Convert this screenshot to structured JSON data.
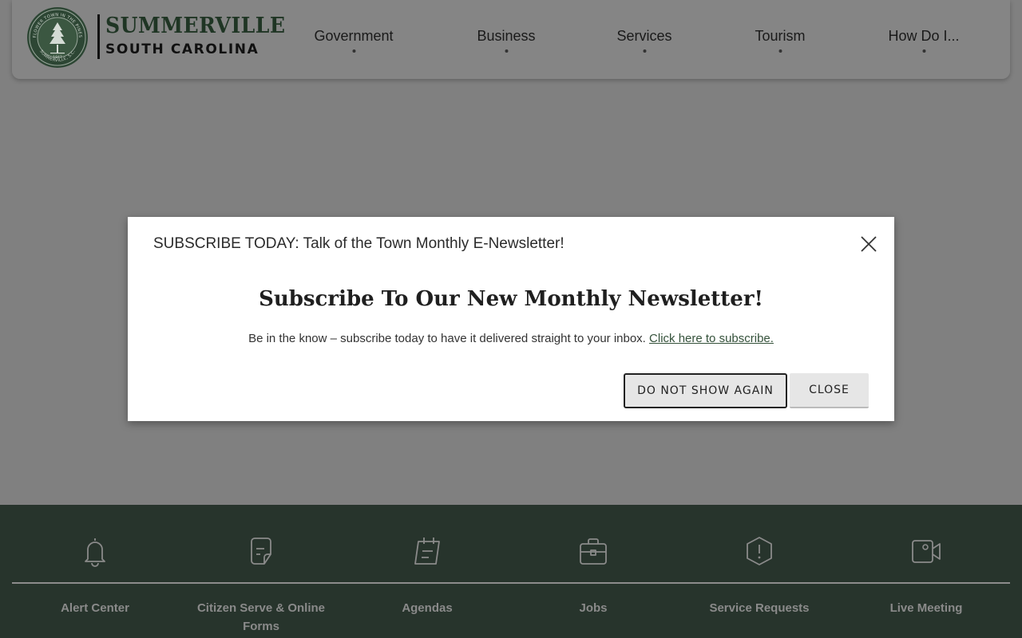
{
  "header": {
    "logo": {
      "name": "SUMMERVILLE",
      "state": "SOUTH CAROLINA",
      "seal_top": "FLOWER TOWN IN THE PINES",
      "seal_bottom": "SUMMERVILLE, S.C.",
      "seal_year": "1847"
    },
    "nav": [
      {
        "label": "Government"
      },
      {
        "label": "Business"
      },
      {
        "label": "Services"
      },
      {
        "label": "Tourism"
      },
      {
        "label": "How Do I..."
      }
    ]
  },
  "modal": {
    "title": "SUBSCRIBE TODAY: Talk of the Town Monthly E-Newsletter!",
    "heading": "Subscribe To Our New Monthly Newsletter!",
    "body_text": "Be in the know – subscribe today to have it delivered straight to your inbox.",
    "link_text": "Click here to subscribe.",
    "dont_show_label": "DO NOT SHOW AGAIN",
    "close_label": "CLOSE"
  },
  "footer": {
    "links": [
      {
        "label": "Alert Center",
        "icon": "bell-icon"
      },
      {
        "label": "Citizen Serve & Online Forms",
        "icon": "document-icon"
      },
      {
        "label": "Agendas",
        "icon": "calendar-icon"
      },
      {
        "label": "Jobs",
        "icon": "briefcase-icon"
      },
      {
        "label": "Service Requests",
        "icon": "alert-hexagon-icon"
      },
      {
        "label": "Live Meeting",
        "icon": "video-camera-icon"
      }
    ]
  },
  "colors": {
    "overlay_bg": "#808080",
    "brand_green": "#27342c",
    "link_green": "#34513a"
  }
}
